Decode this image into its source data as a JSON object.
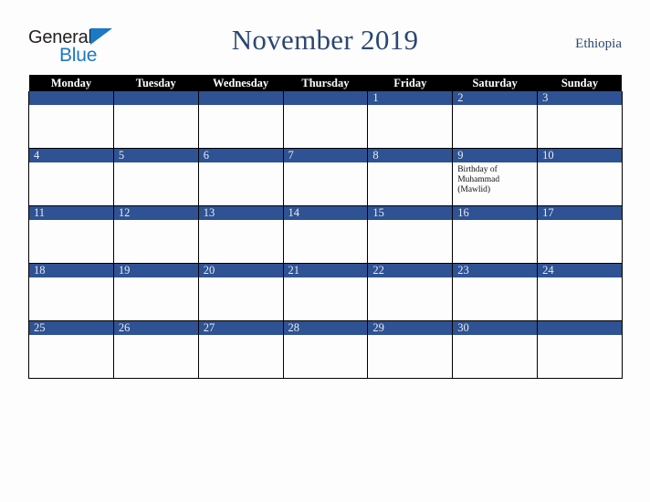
{
  "brand": {
    "word_one": "General",
    "word_two": "Blue",
    "triangle_color": "#1b79c6",
    "word_one_color": "#231f20",
    "word_two_color": "#1b79c6"
  },
  "header": {
    "title": "November 2019",
    "country": "Ethiopia",
    "title_color": "#2c4770"
  },
  "theme": {
    "header_row_bg": "#000000",
    "header_row_fg": "#ffffff",
    "date_band_bg": "#2e5293",
    "date_band_fg": "#e9ecf3",
    "cell_bg": "#fdfdfd",
    "page_bg": "#fdfdfd",
    "border": "#000000"
  },
  "weekday_headers": [
    "Monday",
    "Tuesday",
    "Wednesday",
    "Thursday",
    "Friday",
    "Saturday",
    "Sunday"
  ],
  "weeks": [
    [
      {
        "day": "",
        "events": []
      },
      {
        "day": "",
        "events": []
      },
      {
        "day": "",
        "events": []
      },
      {
        "day": "",
        "events": []
      },
      {
        "day": "1",
        "events": []
      },
      {
        "day": "2",
        "events": []
      },
      {
        "day": "3",
        "events": []
      }
    ],
    [
      {
        "day": "4",
        "events": []
      },
      {
        "day": "5",
        "events": []
      },
      {
        "day": "6",
        "events": []
      },
      {
        "day": "7",
        "events": []
      },
      {
        "day": "8",
        "events": []
      },
      {
        "day": "9",
        "events": [
          "Birthday of Muhammad (Mawlid)"
        ]
      },
      {
        "day": "10",
        "events": []
      }
    ],
    [
      {
        "day": "11",
        "events": []
      },
      {
        "day": "12",
        "events": []
      },
      {
        "day": "13",
        "events": []
      },
      {
        "day": "14",
        "events": []
      },
      {
        "day": "15",
        "events": []
      },
      {
        "day": "16",
        "events": []
      },
      {
        "day": "17",
        "events": []
      }
    ],
    [
      {
        "day": "18",
        "events": []
      },
      {
        "day": "19",
        "events": []
      },
      {
        "day": "20",
        "events": []
      },
      {
        "day": "21",
        "events": []
      },
      {
        "day": "22",
        "events": []
      },
      {
        "day": "23",
        "events": []
      },
      {
        "day": "24",
        "events": []
      }
    ],
    [
      {
        "day": "25",
        "events": []
      },
      {
        "day": "26",
        "events": []
      },
      {
        "day": "27",
        "events": []
      },
      {
        "day": "28",
        "events": []
      },
      {
        "day": "29",
        "events": []
      },
      {
        "day": "30",
        "events": []
      },
      {
        "day": "",
        "events": []
      }
    ]
  ]
}
